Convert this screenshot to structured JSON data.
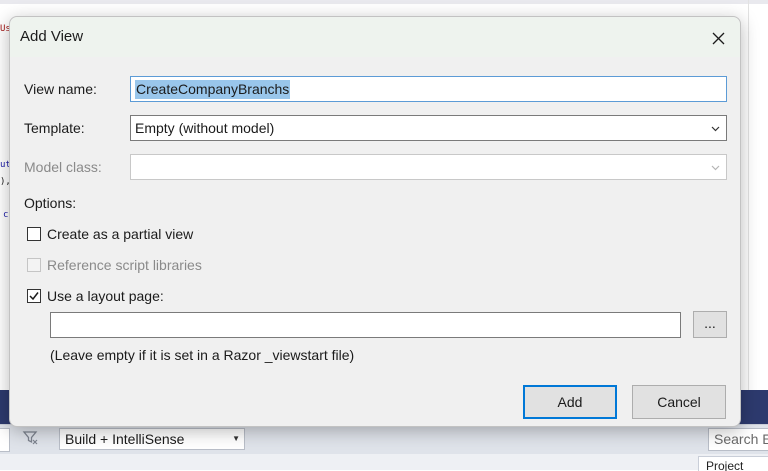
{
  "dialog": {
    "title": "Add View",
    "close_icon": "close-icon",
    "fields": {
      "view_name_label": "View name:",
      "view_name_value": "CreateCompanyBranchs",
      "template_label": "Template:",
      "template_value": "Empty (without model)",
      "model_class_label": "Model class:",
      "model_class_value": ""
    },
    "options": {
      "heading": "Options:",
      "partial_view_label": "Create as a partial view",
      "partial_view_checked": false,
      "script_libraries_label": "Reference script libraries",
      "script_libraries_checked": false,
      "script_libraries_enabled": false,
      "layout_page_label": "Use a layout page:",
      "layout_page_checked": true,
      "layout_path_value": "",
      "browse_label": "...",
      "hint": "(Leave empty if it is set in a Razor _viewstart file)"
    },
    "buttons": {
      "add": "Add",
      "cancel": "Cancel"
    }
  },
  "background": {
    "build_config": "Build + IntelliSense",
    "search_text": "Search E",
    "project_tab": "Project",
    "accent_band_color": "#2d3a6e",
    "code_fragments": [
      "Us",
      "ut",
      "),",
      "c"
    ]
  }
}
